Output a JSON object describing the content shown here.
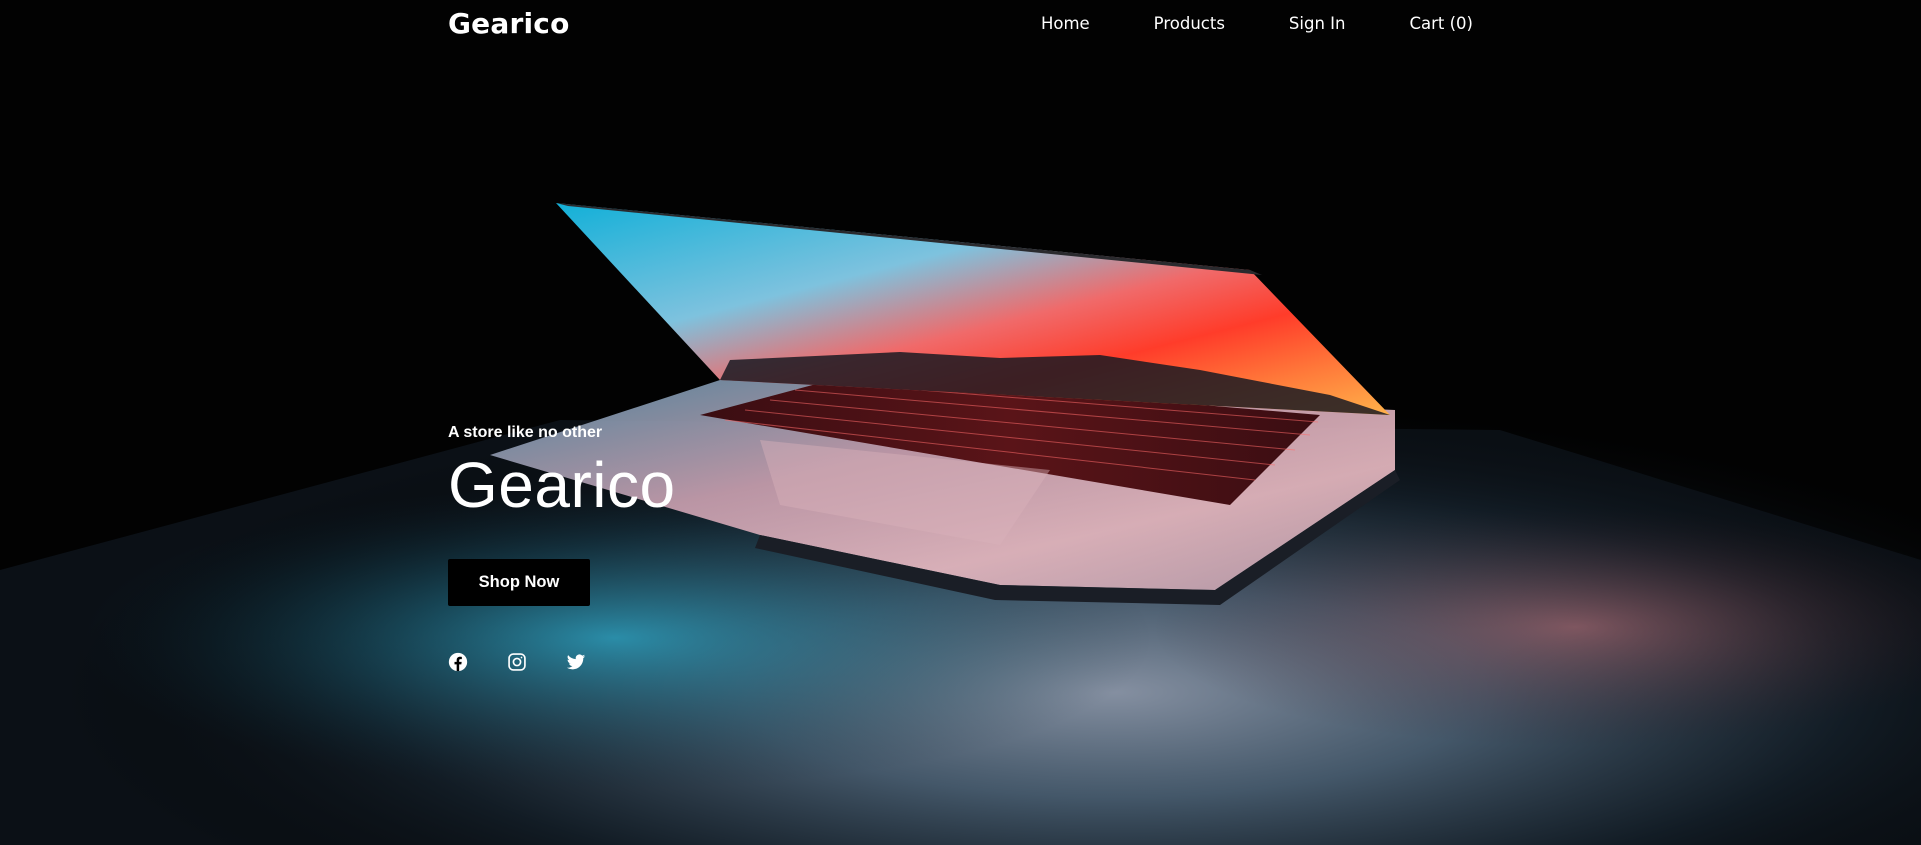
{
  "header": {
    "brand": "Gearico",
    "nav": [
      {
        "label": "Home"
      },
      {
        "label": "Products"
      },
      {
        "label": "Sign In"
      },
      {
        "label": "Cart (0)"
      }
    ]
  },
  "hero": {
    "tagline": "A store like no other",
    "title": "Gearico",
    "cta_label": "Shop Now",
    "background_image": "laptop-glowing-screen-dark-scene"
  },
  "socials": [
    {
      "icon": "facebook-icon"
    },
    {
      "icon": "instagram-icon"
    },
    {
      "icon": "twitter-icon"
    }
  ],
  "colors": {
    "background": "#000000",
    "text": "#ffffff",
    "button": "#000000"
  }
}
